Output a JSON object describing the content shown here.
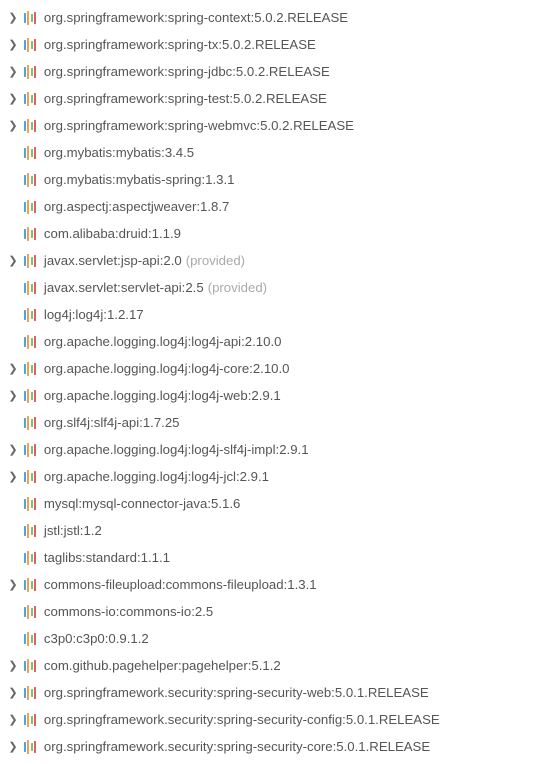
{
  "dependencies": [
    {
      "label": "org.springframework:spring-context:5.0.2.RELEASE",
      "expandable": true,
      "scope": null
    },
    {
      "label": "org.springframework:spring-tx:5.0.2.RELEASE",
      "expandable": true,
      "scope": null
    },
    {
      "label": "org.springframework:spring-jdbc:5.0.2.RELEASE",
      "expandable": true,
      "scope": null
    },
    {
      "label": "org.springframework:spring-test:5.0.2.RELEASE",
      "expandable": true,
      "scope": null
    },
    {
      "label": "org.springframework:spring-webmvc:5.0.2.RELEASE",
      "expandable": true,
      "scope": null
    },
    {
      "label": "org.mybatis:mybatis:3.4.5",
      "expandable": false,
      "scope": null
    },
    {
      "label": "org.mybatis:mybatis-spring:1.3.1",
      "expandable": false,
      "scope": null
    },
    {
      "label": "org.aspectj:aspectjweaver:1.8.7",
      "expandable": false,
      "scope": null
    },
    {
      "label": "com.alibaba:druid:1.1.9",
      "expandable": false,
      "scope": null
    },
    {
      "label": "javax.servlet:jsp-api:2.0",
      "expandable": true,
      "scope": "(provided)"
    },
    {
      "label": "javax.servlet:servlet-api:2.5",
      "expandable": false,
      "scope": "(provided)"
    },
    {
      "label": "log4j:log4j:1.2.17",
      "expandable": false,
      "scope": null
    },
    {
      "label": "org.apache.logging.log4j:log4j-api:2.10.0",
      "expandable": false,
      "scope": null
    },
    {
      "label": "org.apache.logging.log4j:log4j-core:2.10.0",
      "expandable": true,
      "scope": null
    },
    {
      "label": "org.apache.logging.log4j:log4j-web:2.9.1",
      "expandable": true,
      "scope": null
    },
    {
      "label": "org.slf4j:slf4j-api:1.7.25",
      "expandable": false,
      "scope": null
    },
    {
      "label": "org.apache.logging.log4j:log4j-slf4j-impl:2.9.1",
      "expandable": true,
      "scope": null
    },
    {
      "label": "org.apache.logging.log4j:log4j-jcl:2.9.1",
      "expandable": true,
      "scope": null
    },
    {
      "label": "mysql:mysql-connector-java:5.1.6",
      "expandable": false,
      "scope": null
    },
    {
      "label": "jstl:jstl:1.2",
      "expandable": false,
      "scope": null
    },
    {
      "label": "taglibs:standard:1.1.1",
      "expandable": false,
      "scope": null
    },
    {
      "label": "commons-fileupload:commons-fileupload:1.3.1",
      "expandable": true,
      "scope": null
    },
    {
      "label": "commons-io:commons-io:2.5",
      "expandable": false,
      "scope": null
    },
    {
      "label": "c3p0:c3p0:0.9.1.2",
      "expandable": false,
      "scope": null
    },
    {
      "label": "com.github.pagehelper:pagehelper:5.1.2",
      "expandable": true,
      "scope": null
    },
    {
      "label": "org.springframework.security:spring-security-web:5.0.1.RELEASE",
      "expandable": true,
      "scope": null
    },
    {
      "label": "org.springframework.security:spring-security-config:5.0.1.RELEASE",
      "expandable": true,
      "scope": null
    },
    {
      "label": "org.springframework.security:spring-security-core:5.0.1.RELEASE",
      "expandable": true,
      "scope": null
    }
  ],
  "expander_glyph": "❯",
  "watermark": ""
}
